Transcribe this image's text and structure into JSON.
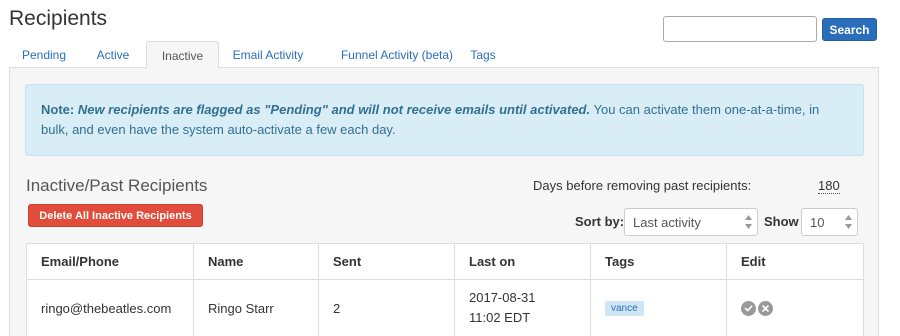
{
  "page": {
    "title": "Recipients"
  },
  "search": {
    "placeholder": "",
    "button_label": "Search"
  },
  "tabs": [
    {
      "label": "Pending"
    },
    {
      "label": "Active"
    },
    {
      "label": "Inactive",
      "active": true
    },
    {
      "label": "Email Activity"
    },
    {
      "label": "Funnel Activity (beta)"
    },
    {
      "label": "Tags"
    }
  ],
  "note": {
    "prefix": "Note:",
    "emphasis": "New recipients are flagged as \"Pending\" and will not receive emails until activated.",
    "rest": " You can activate them one-at-a-time, in bulk, and even have the system auto-activate a few each day."
  },
  "section": {
    "title": "Inactive/Past Recipients",
    "days_label": "Days before removing past recipients:",
    "days_value": "180",
    "delete_button": "Delete All Inactive Recipients"
  },
  "controls": {
    "sort_label": "Sort by:",
    "sort_value": "Last activity",
    "show_label": "Show",
    "show_value": "10"
  },
  "table": {
    "columns": [
      "Email/Phone",
      "Name",
      "Sent",
      "Last on",
      "Tags",
      "Edit"
    ],
    "rows": [
      {
        "email": "ringo@thebeatles.com",
        "name": "Ringo Starr",
        "sent": "2",
        "last_on_date": "2017-08-31",
        "last_on_time": "11:02 EDT",
        "tag": "vance"
      }
    ]
  },
  "colors": {
    "primary": "#2a6ebb",
    "danger": "#e14d3a",
    "info_bg": "#d9edf7",
    "info_text": "#31708f",
    "panel_bg": "#f6f6f6"
  },
  "icons": [
    "updown-arrows-icon",
    "check-circle-icon",
    "remove-circle-icon"
  ]
}
